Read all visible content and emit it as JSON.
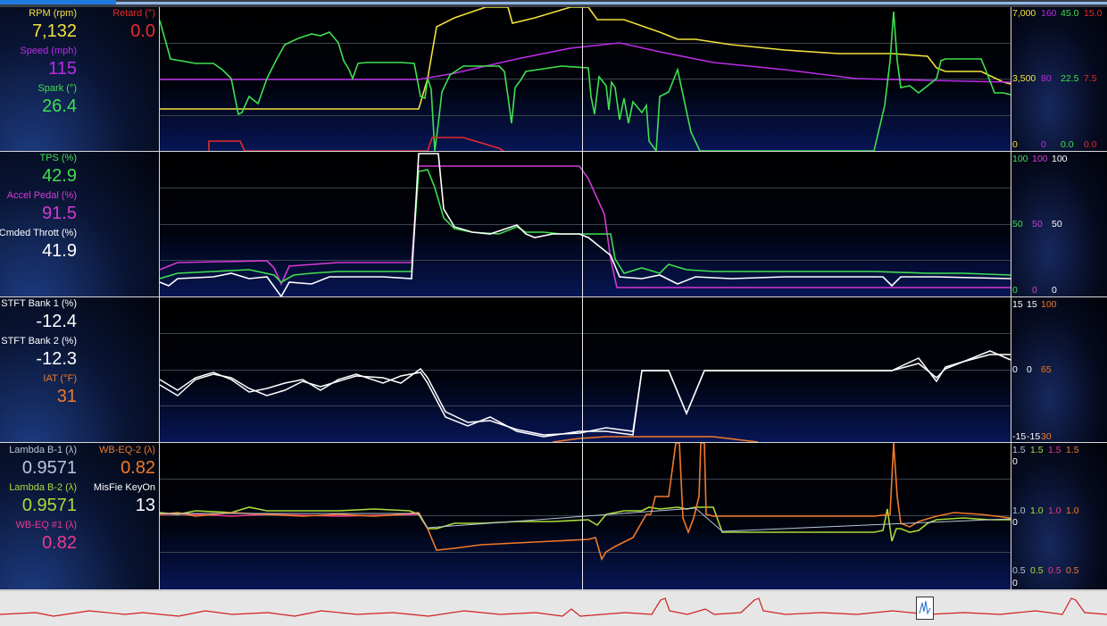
{
  "colors": {
    "yellow": "#f2e13c",
    "purple": "#bb2ce6",
    "green": "#3fe04f",
    "red": "#e52b2b",
    "magenta": "#d43ad4",
    "white": "#ffffff",
    "orange": "#f07a2a",
    "olive": "#aadc3a",
    "lightblue": "#b7c6d8",
    "pink": "#ea3b8c"
  },
  "panels": [
    {
      "params": [
        {
          "name": "RPM (rpm)",
          "value": "7,132"
        },
        {
          "name": "Retard (°)",
          "value": "0.0"
        },
        {
          "name": "Speed (mph)",
          "value": "115"
        },
        {
          "name": "Spark (°)",
          "value": "26.4"
        }
      ],
      "axis": {
        "top": [
          "7,000",
          "160",
          "45.0",
          "15.0"
        ],
        "mid": [
          "3,500",
          "80",
          "22.5",
          "7.5"
        ],
        "bottom": [
          "0",
          "0",
          "0.0",
          "0.0"
        ]
      }
    },
    {
      "params": [
        {
          "name": "TPS (%)",
          "value": "42.9"
        },
        {
          "name": "Accel Pedal (%)",
          "value": "91.5"
        },
        {
          "name": "Cmded Thrott (%)",
          "value": "41.9"
        }
      ],
      "axis": {
        "top": [
          "100",
          "100",
          "100"
        ],
        "mid": [
          "50",
          "50",
          "50"
        ],
        "bottom": [
          "0",
          "0",
          "0"
        ]
      }
    },
    {
      "params": [
        {
          "name": "STFT Bank 1 (%)",
          "value": "-12.4"
        },
        {
          "name": "STFT Bank 2 (%)",
          "value": "-12.3"
        },
        {
          "name": "IAT (°F)",
          "value": "31"
        }
      ],
      "axis": {
        "top": [
          "15",
          "15",
          "100"
        ],
        "mid": [
          "0",
          "0",
          "65"
        ],
        "bottom": [
          "-15",
          "-15",
          "30"
        ]
      }
    },
    {
      "params": [
        {
          "name": "Lambda B-1 (λ)",
          "value": "0.9571"
        },
        {
          "name": "WB-EQ-2 (λ)",
          "value": "0.82"
        },
        {
          "name": "Lambda B-2 (λ)",
          "value": "0.9571"
        },
        {
          "name": "MisFie KeyOn",
          "value": "13"
        },
        {
          "name": "WB-EQ #1 (λ)",
          "value": "0.82"
        }
      ],
      "axis": {
        "top": [
          "1.5",
          "1.5",
          "1.5",
          "1.5"
        ],
        "top2": "0",
        "mid": [
          "1.0",
          "1.0",
          "1.0",
          "1.0"
        ],
        "mid2": "0",
        "bottom": [
          "0.5",
          "0.5",
          "0.5",
          "0.5"
        ],
        "bottom2": "0"
      }
    }
  ]
}
